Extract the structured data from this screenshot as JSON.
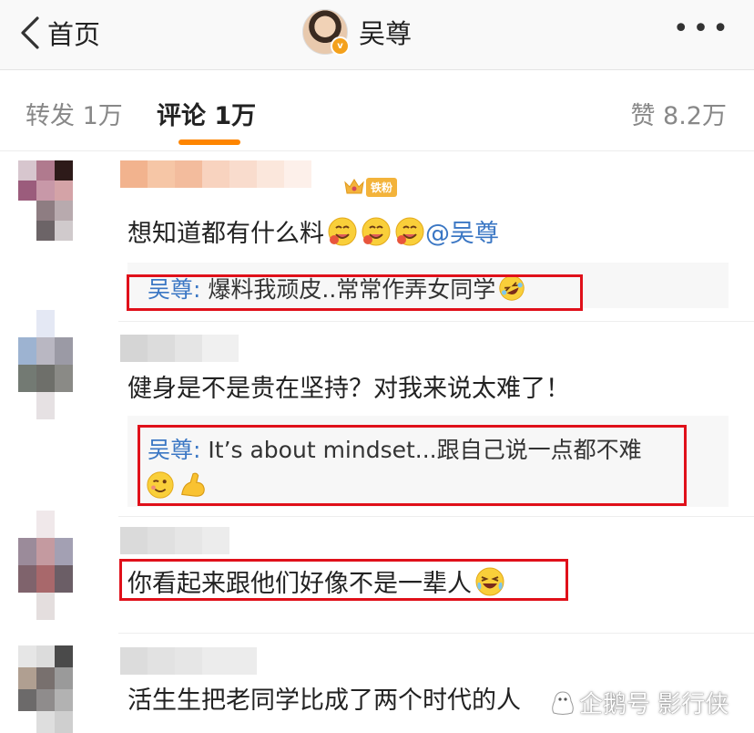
{
  "nav": {
    "back_label": "首页",
    "title": "吴尊",
    "more_label": "•••"
  },
  "tabs": [
    {
      "label": "转发 1万"
    },
    {
      "label": "评论 1万"
    },
    {
      "label": "赞 8.2万"
    }
  ],
  "comments": [
    {
      "badge": "铁粉",
      "text": "想知道都有什么料",
      "mention": "@吴尊",
      "reply": {
        "name": "吴尊",
        "text": "爆料我顽皮..常常作弄女同学"
      }
    },
    {
      "text": "健身是不是贵在坚持？对我来说太难了！",
      "reply": {
        "name": "吴尊",
        "line1": "It’s about mindset...跟自己说一点都不难"
      }
    },
    {
      "text": "你看起来跟他们好像不是一辈人"
    },
    {
      "text": "活生生把老同学比成了两个时代的人"
    }
  ],
  "watermark": "企鹅号 影行侠",
  "colors": {
    "accent": "#fe8500",
    "link": "#3b77c4",
    "highlight_box": "#e0101a"
  }
}
